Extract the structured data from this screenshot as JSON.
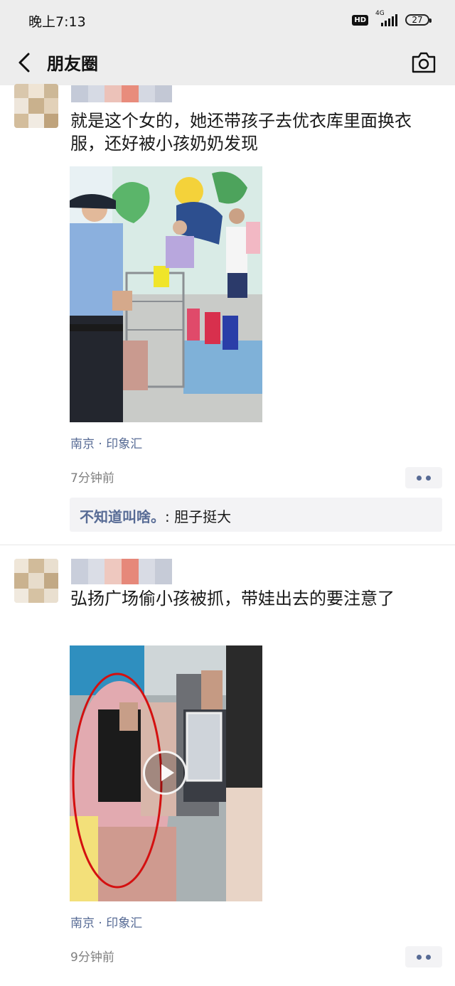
{
  "status_bar": {
    "time": "晚上7:13",
    "hd": "HD",
    "network": "4G",
    "battery": "27"
  },
  "nav": {
    "title": "朋友圈",
    "back_icon": "chevron-left-icon",
    "camera_icon": "camera-icon"
  },
  "posts": [
    {
      "text": "就是这个女的，她还带孩子去优衣库里面换衣服，还好被小孩奶奶发现",
      "location": "南京 · 印象汇",
      "time": "7分钟前",
      "media_type": "photo",
      "comment": {
        "author": "不知道叫啥。",
        "text": ": 胆子挺大"
      }
    },
    {
      "text": "弘扬广场偷小孩被抓，带娃出去的要注意了",
      "location": "南京 · 印象汇",
      "time": "9分钟前",
      "media_type": "video"
    }
  ],
  "colors": {
    "bar_bg": "#ededed",
    "link": "#576b95",
    "meta_gray": "#7f7f7f",
    "comment_bg": "#f3f3f5"
  }
}
